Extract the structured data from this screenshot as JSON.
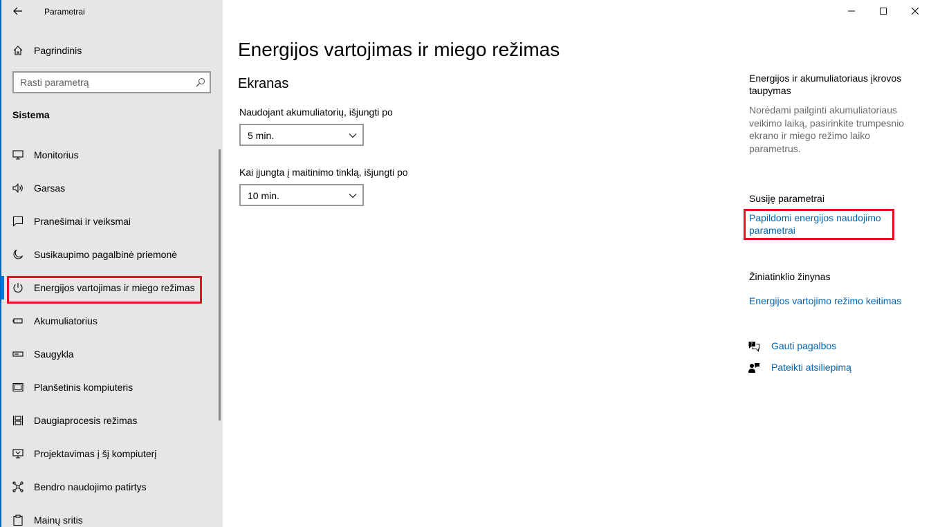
{
  "window": {
    "title": "Parametrai",
    "controls": [
      "minimize",
      "maximize",
      "close"
    ]
  },
  "sidebar": {
    "home_label": "Pagrindinis",
    "search_placeholder": "Rasti parametrą",
    "section": "Sistema",
    "items": [
      {
        "label": "Monitorius",
        "icon": "monitor-icon"
      },
      {
        "label": "Garsas",
        "icon": "speaker-icon"
      },
      {
        "label": "Pranešimai ir veiksmai",
        "icon": "notification-icon"
      },
      {
        "label": "Susikaupimo pagalbinė priemonė",
        "icon": "moon-icon"
      },
      {
        "label": "Energijos vartojimas ir miego režimas",
        "icon": "power-icon",
        "selected": true
      },
      {
        "label": "Akumuliatorius",
        "icon": "battery-icon"
      },
      {
        "label": "Saugykla",
        "icon": "storage-icon"
      },
      {
        "label": "Planšetinis kompiuteris",
        "icon": "tablet-icon"
      },
      {
        "label": "Daugiaprocesis režimas",
        "icon": "multitasking-icon"
      },
      {
        "label": "Projektavimas į šį kompiuterį",
        "icon": "projecting-icon"
      },
      {
        "label": "Bendro naudojimo patirtys",
        "icon": "shared-experiences-icon"
      },
      {
        "label": "Mainų sritis",
        "icon": "clipboard-icon"
      }
    ]
  },
  "main": {
    "title": "Energijos vartojimas ir miego režimas",
    "screen_group": "Ekranas",
    "battery_label": "Naudojant akumuliatorių, išjungti po",
    "battery_value": "5 min.",
    "plugged_label": "Kai įjungta į maitinimo tinklą, išjungti po",
    "plugged_value": "10 min."
  },
  "aside": {
    "battery_save_title": "Energijos ir akumuliatoriaus įkrovos taupymas",
    "battery_save_desc": "Norėdami pailginti akumuliatoriaus veikimo laiką, pasirinkite trumpesnio ekrano ir miego režimo laiko parametrus.",
    "related_title": "Susiję parametrai",
    "related_link": "Papildomi energijos naudojimo parametrai",
    "web_help_title": "Žiniatinklio žinynas",
    "web_help_link": "Energijos vartojimo režimo keitimas",
    "get_help": "Gauti pagalbos",
    "feedback": "Pateikti atsiliepimą"
  },
  "colors": {
    "accent": "#0078d7",
    "link": "#0063b1",
    "highlight": "#e81123",
    "sidebar_bg": "#e6e6e6"
  }
}
